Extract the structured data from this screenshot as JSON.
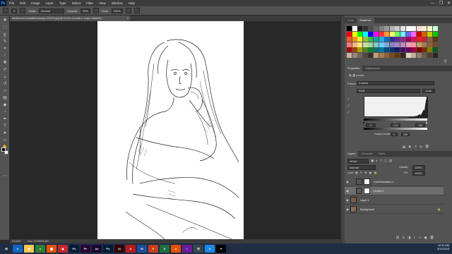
{
  "app": {
    "logo": "Ps",
    "accent": "#31a8ff"
  },
  "menu": [
    "File",
    "Edit",
    "Image",
    "Layer",
    "Type",
    "Select",
    "Filter",
    "View",
    "Window",
    "Help"
  ],
  "window_controls": {
    "minimize": "—",
    "maximize": "❐",
    "close": "✕"
  },
  "options_bar": {
    "brush_size": "3",
    "mode_label": "Mode:",
    "mode_value": "Normal",
    "opacity_label": "Opacity:",
    "opacity_value": "40%",
    "flow_label": "Flow:",
    "flow_value": "100%"
  },
  "document": {
    "tab_title": "adolescent-beautiful-beauty-247876.jpg @ 24.3% (Levels 1, Layer Mask/8) *",
    "close": "×"
  },
  "status_bar": {
    "zoom": "24.29%",
    "doc_size": "Doc: 22.9M/93.6M"
  },
  "tools": [
    "move",
    "marquee",
    "lasso",
    "quick-select",
    "crop",
    "eyedropper",
    "healing",
    "brush",
    "clone",
    "history",
    "eraser",
    "gradient",
    "blur",
    "dodge",
    "pen",
    "type",
    "path-select",
    "rectangle",
    "hand",
    "zoom",
    "more"
  ],
  "swatches_panel": {
    "tabs": [
      "Color",
      "Swatches"
    ],
    "active_tab": "Swatches",
    "colors": [
      "#000000",
      "#ffffff",
      "#1a1a1a",
      "#333333",
      "#4d4d4d",
      "#666666",
      "#808080",
      "#999999",
      "#b3b3b3",
      "#cccccc",
      "#e6e6e6",
      "#ffffff",
      "#f7f7f7",
      "#ffd9d9",
      "#ffeecc",
      "#ffffcc",
      "#ccffcc",
      "#ff0000",
      "#ffff00",
      "#00ff00",
      "#00ffff",
      "#0000ff",
      "#ff00ff",
      "#ff3333",
      "#ff9933",
      "#ffff66",
      "#66ff66",
      "#66ffff",
      "#6666ff",
      "#ff66ff",
      "#cc0000",
      "#cc6600",
      "#cccc00",
      "#00cc00",
      "#f15a24",
      "#f7931e",
      "#fcee21",
      "#8cc63f",
      "#39b54a",
      "#00a99d",
      "#29abe2",
      "#0071bc",
      "#2e3192",
      "#662d91",
      "#93278f",
      "#9e005d",
      "#d4145a",
      "#ed1c24",
      "#c1272d",
      "#8c6239",
      "#603813",
      "#ed7872",
      "#f9b27f",
      "#fbe883",
      "#c4df9b",
      "#a3d39c",
      "#7accc8",
      "#6dcff6",
      "#7da7d9",
      "#8781bd",
      "#a186be",
      "#bd8cbf",
      "#f49ac1",
      "#f6989d",
      "#c69c6d",
      "#a67c52",
      "#8c6239",
      "#754c24",
      "#9e0b0f",
      "#a0410d",
      "#aba000",
      "#598527",
      "#197b30",
      "#00746b",
      "#0076a3",
      "#004a80",
      "#003471",
      "#1b1464",
      "#440e62",
      "#630460",
      "#9e0039",
      "#790000",
      "#7b2e00",
      "#827b00",
      "#005e20",
      "#c7b299",
      "#998675",
      "#736357",
      "#534741",
      "#362f2d",
      "#c69c6d",
      "#a67c52",
      "#8c6239",
      "#754c24",
      "#603813",
      "#3c2415",
      "#e0d3c2",
      "#bfae9a",
      "#8f7f6c",
      "#6b5d4f",
      "#4a4036",
      "#2b251f"
    ]
  },
  "properties_panel": {
    "tabs": [
      "Properties",
      "Adjustments"
    ],
    "active_tab": "Properties",
    "adjustment_name": "Levels",
    "preset_label": "Preset:",
    "preset_value": "Custom",
    "channel_value": "RGB",
    "auto_label": "Auto",
    "input_black": "0",
    "input_gamma": "1.00",
    "input_white": "255",
    "output_label": "Output Levels:",
    "output_black": "0",
    "output_white": "255"
  },
  "layers_panel": {
    "tabs": [
      "Layers",
      "Channels",
      "Paths"
    ],
    "active_tab": "Layers",
    "kind_label": "Kind",
    "blend_mode": "Normal",
    "opacity_label": "Opacity:",
    "opacity_value": "100%",
    "lock_label": "Lock:",
    "fill_label": "Fill:",
    "fill_value": "100%",
    "layers": [
      {
        "name": "Hue/Saturation 1",
        "selected": false
      },
      {
        "name": "Levels 1",
        "selected": true
      },
      {
        "name": "Layer 1",
        "selected": false
      },
      {
        "name": "Background",
        "selected": false
      }
    ]
  },
  "taskbar": {
    "apps": [
      {
        "label": "⊞",
        "color": "#1f2d45"
      },
      {
        "label": "e",
        "color": "#1565c0"
      },
      {
        "label": "▤",
        "color": "#f2c94c"
      },
      {
        "label": "●",
        "color": "#2e7d32"
      },
      {
        "label": "⬤",
        "color": "#e65100"
      },
      {
        "label": "◉",
        "color": "#c62828"
      },
      {
        "label": "Ps",
        "color": "#001d34"
      },
      {
        "label": "Pr",
        "color": "#2a0634"
      },
      {
        "label": "Ae",
        "color": "#1a0633"
      },
      {
        "label": "Ps",
        "color": "#001d34"
      },
      {
        "label": "Ai",
        "color": "#330000"
      },
      {
        "label": "A",
        "color": "#b71c1c"
      },
      {
        "label": "W",
        "color": "#1e4e9c"
      },
      {
        "label": "P",
        "color": "#c43e1c"
      },
      {
        "label": "X",
        "color": "#1d6f42"
      },
      {
        "label": "▲",
        "color": "#e65100"
      },
      {
        "label": "◐",
        "color": "#6a1b9a"
      },
      {
        "label": "☰",
        "color": "#37474f"
      },
      {
        "label": "●",
        "color": "#1e88e5"
      },
      {
        "label": "✦",
        "color": "#000000"
      }
    ],
    "time": "10:32 AM",
    "date": "5/12/2018"
  }
}
